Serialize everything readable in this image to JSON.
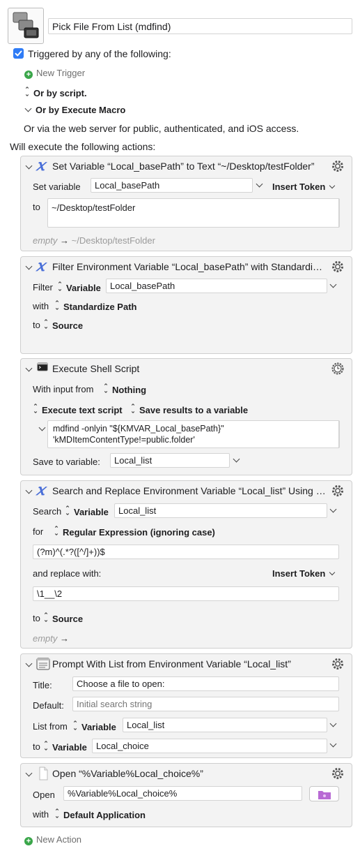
{
  "macro": {
    "name": "Pick File From List (mdfind)",
    "triggered_label": "Triggered by any of the following:",
    "new_trigger": "New Trigger",
    "or_by_script": "Or by script.",
    "or_by_execute_macro": "Or by Execute Macro",
    "web_server_text": "Or via the web server for public, authenticated, and iOS access.",
    "will_execute": "Will execute the following actions:",
    "new_action": "New Action"
  },
  "actions": [
    {
      "title": "Set Variable “Local_basePath” to Text “~/Desktop/testFolder”",
      "set_variable_label": "Set variable",
      "variable": "Local_basePath",
      "insert_token": "Insert Token",
      "to_label": "to",
      "text": "~/Desktop/testFolder",
      "preview_empty": "empty",
      "preview_arrow": "→",
      "preview_value": "~/Desktop/testFolder"
    },
    {
      "title": "Filter Environment Variable “Local_basePath” with Standardize Path",
      "filter_label": "Filter",
      "filter_type": "Variable",
      "variable": "Local_basePath",
      "with_label": "with",
      "with_value": "Standardize Path",
      "to_label": "to",
      "to_value": "Source"
    },
    {
      "title": "Execute Shell Script",
      "with_input_label": "With input from",
      "with_input_value": "Nothing",
      "execute_mode": "Execute text script",
      "save_mode": "Save results to a variable",
      "script_line1": "mdfind -onlyin \"${KMVAR_Local_basePath}\"",
      "script_line2": "'kMDItemContentType!=public.folder'",
      "save_to_label": "Save to variable:",
      "save_to_value": "Local_list"
    },
    {
      "title": "Search and Replace Environment Variable “Local_list” Using Regular Expression",
      "search_label": "Search",
      "search_type": "Variable",
      "variable": "Local_list",
      "for_label": "for",
      "for_value": "Regular Expression (ignoring case)",
      "regex": "(?m)^(.*?([^/]+))$",
      "replace_label": "and replace with:",
      "insert_token": "Insert Token",
      "replacement": "\\1__\\2",
      "to_label": "to",
      "to_value": "Source",
      "preview_empty": "empty",
      "preview_arrow": "→"
    },
    {
      "title": "Prompt With List from Environment Variable “Local_list”",
      "title_label": "Title:",
      "title_value": "Choose a file to open:",
      "default_label": "Default:",
      "default_placeholder": "Initial search string",
      "list_from_label": "List from",
      "list_from_type": "Variable",
      "list_from_value": "Local_list",
      "to_label": "to",
      "to_type": "Variable",
      "to_value": "Local_choice"
    },
    {
      "title": "Open “%Variable%Local_choice%”",
      "open_label": "Open",
      "open_value": "%Variable%Local_choice%",
      "with_label": "with",
      "with_value": "Default Application"
    }
  ],
  "colors": {
    "accent": "#2f7cf6",
    "green": "#3aa64a",
    "variable_icon": "#4a6fd8",
    "folder_icon": "#b86ad4"
  },
  "icons": [
    "macro-icon",
    "checkbox-icon",
    "plus-icon",
    "variable-x-icon",
    "gear-icon",
    "terminal-icon",
    "clock-gear-icon",
    "prompt-list-icon",
    "document-icon",
    "folder-icon"
  ]
}
